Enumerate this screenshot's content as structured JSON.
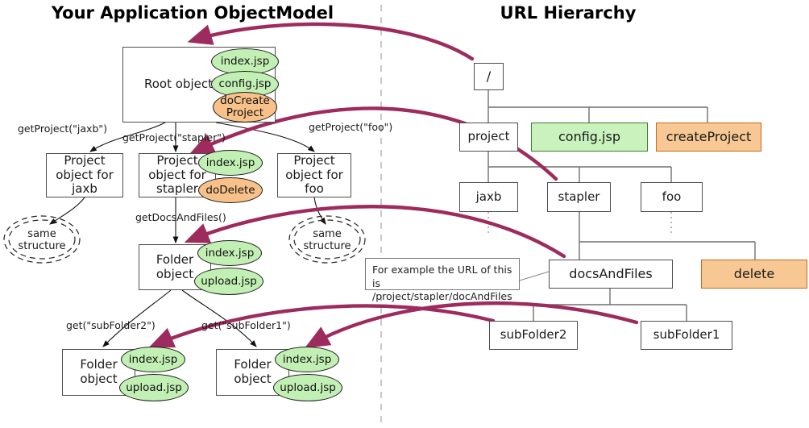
{
  "diagram": {
    "titles": {
      "left": "Your Application ObjectModel",
      "right": "URL Hierarchy"
    },
    "colors": {
      "jsp_green_fill": "#c9f2bd",
      "jsp_green_border": "#3a7d2c",
      "action_orange_fill": "#f8c894",
      "action_orange_border": "#c46a1c",
      "mapping_arrow": "#9e2b5e",
      "box_border": "#4d4d4d",
      "divider": "#bbbbbb"
    },
    "left_panel": {
      "root_object": {
        "label": "Root object"
      },
      "root_views": [
        {
          "label": "index.jsp",
          "kind": "view"
        },
        {
          "label": "config.jsp",
          "kind": "view"
        },
        {
          "label": "doCreate Project",
          "line1": "doCreate",
          "line2": "Project",
          "kind": "action"
        }
      ],
      "edge_labels": [
        {
          "label": "getProject(\"jaxb\")"
        },
        {
          "label": "getProject(\"stapler\")"
        },
        {
          "label": "getProject(\"foo\")"
        },
        {
          "label": "getDocsAndFiles()"
        },
        {
          "label": "get(\"subFolder2\")"
        },
        {
          "label": "get(\"subFolder1\")"
        }
      ],
      "project_objects": [
        {
          "line1": "Project",
          "line2": "object for",
          "line3": "jaxb"
        },
        {
          "line1": "Project",
          "line2": "object for",
          "line3": "stapler"
        },
        {
          "line1": "Project",
          "line2": "object for",
          "line3": "foo"
        }
      ],
      "stapler_views": [
        {
          "label": "index.jsp",
          "kind": "view"
        },
        {
          "label": "doDelete",
          "kind": "action"
        }
      ],
      "clouds": [
        {
          "line1": "same",
          "line2": "structure"
        },
        {
          "line1": "same",
          "line2": "structure"
        }
      ],
      "folder_object": {
        "line1": "Folder",
        "line2": "object"
      },
      "folder_views": [
        {
          "label": "index.jsp",
          "kind": "view"
        },
        {
          "label": "upload.jsp",
          "kind": "view"
        }
      ],
      "sub_folders": [
        {
          "box": {
            "line1": "Folder",
            "line2": "object"
          },
          "views": [
            {
              "label": "index.jsp",
              "kind": "view"
            },
            {
              "label": "upload.jsp",
              "kind": "view"
            }
          ]
        },
        {
          "box": {
            "line1": "Folder",
            "line2": "object"
          },
          "views": [
            {
              "label": "index.jsp",
              "kind": "view"
            },
            {
              "label": "upload.jsp",
              "kind": "view"
            }
          ]
        }
      ]
    },
    "right_panel": {
      "root": {
        "label": "/"
      },
      "level1": [
        {
          "label": "project",
          "kind": "path"
        },
        {
          "label": "config.jsp",
          "kind": "view"
        },
        {
          "label": "createProject",
          "kind": "action"
        }
      ],
      "level2": [
        {
          "label": "jaxb",
          "kind": "path"
        },
        {
          "label": "stapler",
          "kind": "path"
        },
        {
          "label": "foo",
          "kind": "path"
        }
      ],
      "level3": [
        {
          "label": "docsAndFiles",
          "kind": "path"
        },
        {
          "label": "delete",
          "kind": "action"
        }
      ],
      "level4": [
        {
          "label": "subFolder2",
          "kind": "path"
        },
        {
          "label": "subFolder1",
          "kind": "path"
        }
      ]
    },
    "callout": {
      "line1": "For example the URL of this is",
      "line2": "/project/stapler/docAndFiles"
    }
  }
}
